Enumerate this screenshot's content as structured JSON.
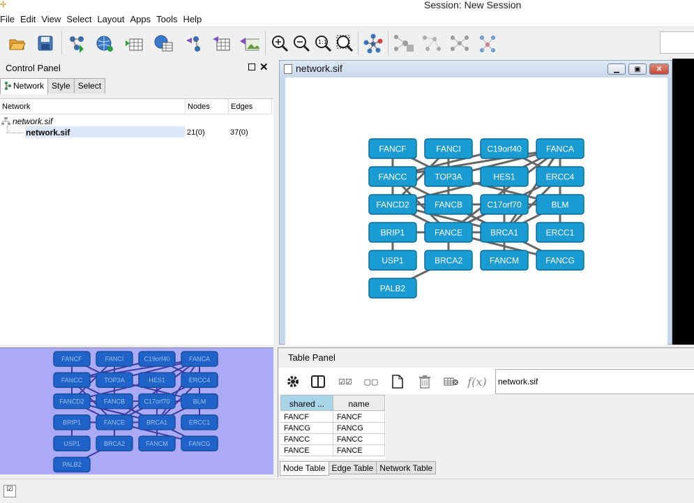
{
  "window": {
    "title": "Session: New Session"
  },
  "menubar": [
    "File",
    "Edit",
    "View",
    "Select",
    "Layout",
    "Apps",
    "Tools",
    "Help"
  ],
  "control_panel": {
    "title": "Control Panel",
    "tabs": [
      "Network",
      "Style",
      "Select"
    ],
    "columns": [
      "Network",
      "Nodes",
      "Edges"
    ],
    "collection": "network.sif",
    "rows": [
      {
        "name": "network.sif",
        "nodes": "21(0)",
        "edges": "37(0)"
      }
    ]
  },
  "network_window": {
    "title": "network.sif"
  },
  "network": {
    "node_fill": "#1a9bd1",
    "node_border": "#0a6f98",
    "edge_color": "#666666",
    "nodes": [
      {
        "id": "FANCF",
        "row": 0,
        "col": 0
      },
      {
        "id": "FANCI",
        "row": 0,
        "col": 1
      },
      {
        "id": "C19orf40",
        "row": 0,
        "col": 2
      },
      {
        "id": "FANCA",
        "row": 0,
        "col": 3
      },
      {
        "id": "FANCC",
        "row": 1,
        "col": 0
      },
      {
        "id": "TOP3A",
        "row": 1,
        "col": 1
      },
      {
        "id": "HES1",
        "row": 1,
        "col": 2
      },
      {
        "id": "ERCC4",
        "row": 1,
        "col": 3
      },
      {
        "id": "FANCD2",
        "row": 2,
        "col": 0
      },
      {
        "id": "FANCB",
        "row": 2,
        "col": 1
      },
      {
        "id": "C17orf70",
        "row": 2,
        "col": 2
      },
      {
        "id": "BLM",
        "row": 2,
        "col": 3
      },
      {
        "id": "BRIP1",
        "row": 3,
        "col": 0
      },
      {
        "id": "FANCE",
        "row": 3,
        "col": 1
      },
      {
        "id": "BRCA1",
        "row": 3,
        "col": 2
      },
      {
        "id": "ERCC1",
        "row": 3,
        "col": 3
      },
      {
        "id": "USP1",
        "row": 4,
        "col": 0
      },
      {
        "id": "BRCA2",
        "row": 4,
        "col": 1
      },
      {
        "id": "FANCM",
        "row": 4,
        "col": 2
      },
      {
        "id": "FANCG",
        "row": 4,
        "col": 3
      },
      {
        "id": "PALB2",
        "row": 5,
        "col": 0
      }
    ],
    "edges": [
      [
        "FANCF",
        "FANCC"
      ],
      [
        "FANCF",
        "TOP3A"
      ],
      [
        "FANCI",
        "FANCD2"
      ],
      [
        "FANCI",
        "TOP3A"
      ],
      [
        "C19orf40",
        "FANCC"
      ],
      [
        "C19orf40",
        "ERCC4"
      ],
      [
        "FANCA",
        "FANCC"
      ],
      [
        "FANCA",
        "TOP3A"
      ],
      [
        "FANCA",
        "HES1"
      ],
      [
        "FANCA",
        "BLM"
      ],
      [
        "FANCA",
        "BRCA1"
      ],
      [
        "FANCA",
        "FANCE"
      ],
      [
        "FANCC",
        "FANCD2"
      ],
      [
        "FANCC",
        "FANCE"
      ],
      [
        "FANCC",
        "BRCA1"
      ],
      [
        "TOP3A",
        "BLM"
      ],
      [
        "TOP3A",
        "FANCB"
      ],
      [
        "HES1",
        "FANCD2"
      ],
      [
        "HES1",
        "BRCA1"
      ],
      [
        "ERCC4",
        "BRCA1"
      ],
      [
        "ERCC4",
        "FANCE"
      ],
      [
        "ERCC4",
        "ERCC1"
      ],
      [
        "FANCD2",
        "BRCA1"
      ],
      [
        "FANCD2",
        "FANCE"
      ],
      [
        "FANCD2",
        "BLM"
      ],
      [
        "FANCB",
        "BRCA1"
      ],
      [
        "C17orf70",
        "FANCE"
      ],
      [
        "C17orf70",
        "BRCA1"
      ],
      [
        "BLM",
        "BRCA1"
      ],
      [
        "BRIP1",
        "FANCE"
      ],
      [
        "BRIP1",
        "BRCA1"
      ],
      [
        "BRIP1",
        "USP1"
      ],
      [
        "FANCE",
        "BRCA2"
      ],
      [
        "FANCE",
        "FANCG"
      ],
      [
        "BRCA1",
        "FANCG"
      ],
      [
        "FANCM",
        "BRCA1"
      ],
      [
        "PALB2",
        "BRCA2"
      ]
    ]
  },
  "table_panel": {
    "title": "Table Panel",
    "search_value": "network.sif",
    "columns": [
      "shared ...",
      "name"
    ],
    "rows": [
      [
        "FANCF",
        "FANCF"
      ],
      [
        "FANCG",
        "FANCG"
      ],
      [
        "FANCC",
        "FANCC"
      ],
      [
        "FANCE",
        "FANCE"
      ]
    ],
    "tabs": [
      "Node Table",
      "Edge Table",
      "Network Table"
    ],
    "fx_label": "f(x)"
  },
  "icons": {
    "toolbar": [
      "open-session-icon",
      "save-session-icon",
      "import-network-file-icon",
      "import-network-url-icon",
      "import-table-file-icon",
      "import-table-url-icon",
      "export-network-icon",
      "export-table-icon",
      "export-image-icon",
      "zoom-in-icon",
      "zoom-out-icon",
      "zoom-fit-icon",
      "zoom-selected-icon",
      "apply-layout-icon",
      "hide-selected-icon",
      "first-neighbors-icon",
      "show-all-icon",
      "select-icon"
    ]
  }
}
